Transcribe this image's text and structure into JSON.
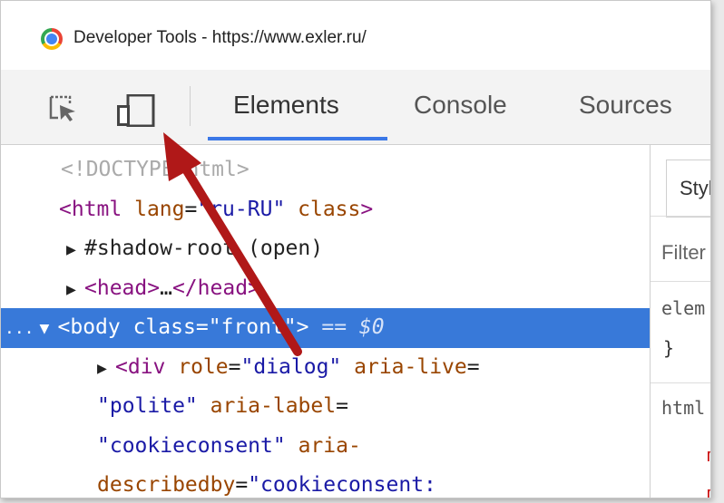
{
  "window": {
    "title": "Developer Tools - https://www.exler.ru/"
  },
  "toolbar": {
    "tabs": [
      {
        "label": "Elements",
        "active": true
      },
      {
        "label": "Console",
        "active": false
      },
      {
        "label": "Sources",
        "active": false
      }
    ],
    "icons": [
      "inspect-element-icon",
      "device-toolbar-icon"
    ]
  },
  "elements": {
    "lines": [
      {
        "doctype": "<!DOCTYPE html>"
      },
      {
        "open": "<html",
        "attr": " lang",
        "eq": "=",
        "val": "\"ru-RU\"",
        "attr2": " class",
        "close": ">"
      },
      {
        "tri": "▶",
        "text": "#shadow-root (open)"
      },
      {
        "tri": "▶",
        "open": "<head>",
        "ellipsis": "…",
        "close": "</head>"
      },
      {
        "prefix": "...",
        "tri": "▼",
        "open": "<body",
        "attr": " class",
        "eq": "=",
        "val": "\"front\"",
        "close": ">",
        "marker": " == ",
        "ref": "$0"
      },
      {
        "tri": "▶",
        "open": "<div",
        "attr": " role",
        "eq": "=",
        "val": "\"dialog\"",
        "attr2": " aria-live",
        "eq2": "="
      },
      {
        "val": "\"polite\"",
        "attr": " aria-label",
        "eq": "="
      },
      {
        "val": "\"cookieconsent\"",
        "attr": " aria-"
      },
      {
        "attr": "describedby",
        "eq": "=",
        "val": "\"cookieconsent:"
      }
    ]
  },
  "styles": {
    "tab_label": "Styl",
    "filter_label": "Filter",
    "element_rule": "elem",
    "close_brace": "}",
    "html_rule": "html",
    "prop1": "m",
    "prop2": "m"
  },
  "colors": {
    "selection": "#3879d9",
    "tab_underline": "#3b78e7",
    "arrow": "#b01818"
  }
}
